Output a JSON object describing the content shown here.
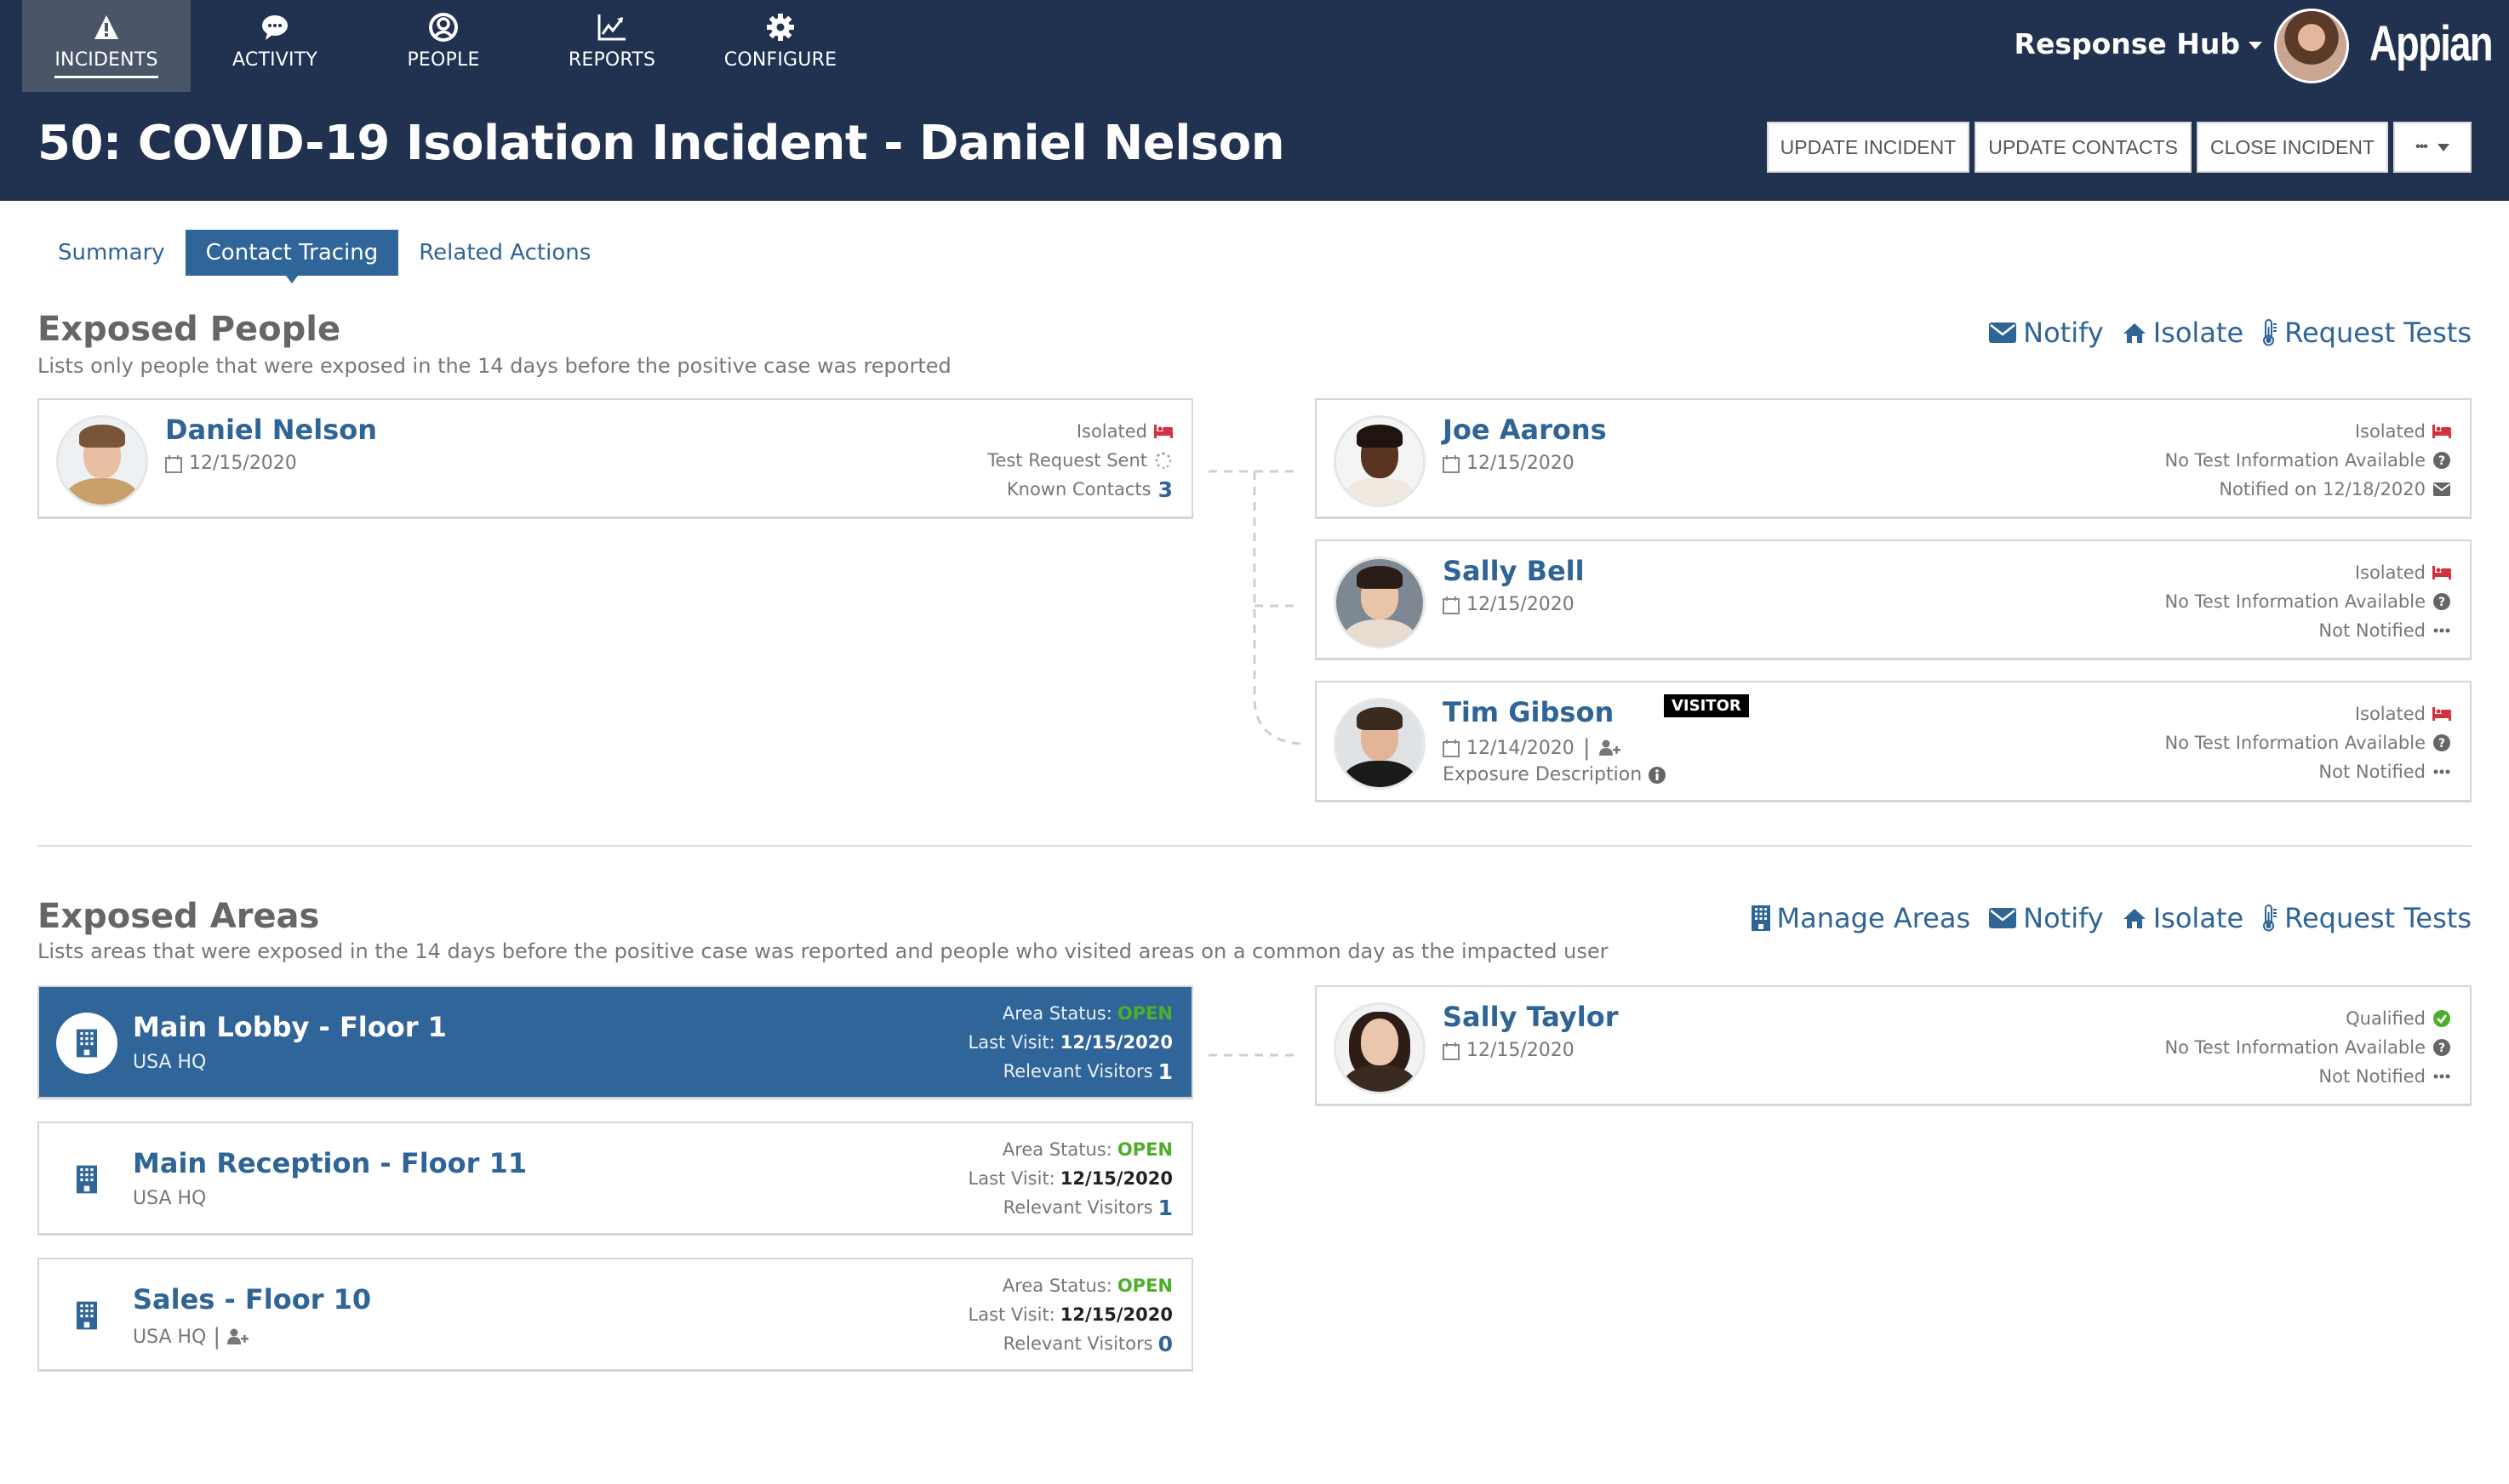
{
  "nav": {
    "items": [
      {
        "label": "INCIDENTS",
        "icon": "warning-icon",
        "active": true
      },
      {
        "label": "ACTIVITY",
        "icon": "chat-bubble-icon",
        "active": false
      },
      {
        "label": "PEOPLE",
        "icon": "user-circle-icon",
        "active": false
      },
      {
        "label": "REPORTS",
        "icon": "line-chart-icon",
        "active": false
      },
      {
        "label": "CONFIGURE",
        "icon": "gear-icon",
        "active": false
      }
    ],
    "site_name": "Response Hub",
    "logo": "Appian"
  },
  "header": {
    "title": "50: COVID-19 Isolation Incident - Daniel Nelson",
    "actions": [
      "UPDATE INCIDENT",
      "UPDATE CONTACTS",
      "CLOSE INCIDENT"
    ],
    "more_label": "•••"
  },
  "tabs": [
    {
      "label": "Summary",
      "active": false
    },
    {
      "label": "Contact Tracing",
      "active": true
    },
    {
      "label": "Related Actions",
      "active": false
    }
  ],
  "exposed_people": {
    "title": "Exposed People",
    "subtitle": "Lists only people that were exposed in the 14 days before the positive case was reported",
    "actions": [
      {
        "label": "Notify",
        "icon": "envelope-icon"
      },
      {
        "label": "Isolate",
        "icon": "home-icon"
      },
      {
        "label": "Request Tests",
        "icon": "thermometer-icon"
      }
    ],
    "index_case": {
      "name": "Daniel Nelson",
      "date": "12/15/2020",
      "status": [
        {
          "text": "Isolated",
          "icon": "bed-icon"
        },
        {
          "text": "Test Request Sent",
          "icon": "spinner-icon"
        },
        {
          "text": "Known Contacts",
          "value": "3"
        }
      ]
    },
    "contacts": [
      {
        "name": "Joe Aarons",
        "date": "12/15/2020",
        "status": [
          {
            "text": "Isolated",
            "icon": "bed-icon"
          },
          {
            "text": "No Test Information Available",
            "icon": "question-circle-icon"
          },
          {
            "text": "Notified on 12/18/2020",
            "icon": "envelope-icon"
          }
        ]
      },
      {
        "name": "Sally Bell",
        "date": "12/15/2020",
        "status": [
          {
            "text": "Isolated",
            "icon": "bed-icon"
          },
          {
            "text": "No Test Information Available",
            "icon": "question-circle-icon"
          },
          {
            "text": "Not Notified",
            "icon": "ellipsis-icon"
          }
        ]
      },
      {
        "name": "Tim Gibson",
        "date": "12/14/2020",
        "badge": "VISITOR",
        "extra": "Exposure Description",
        "status": [
          {
            "text": "Isolated",
            "icon": "bed-icon"
          },
          {
            "text": "No Test Information Available",
            "icon": "question-circle-icon"
          },
          {
            "text": "Not Notified",
            "icon": "ellipsis-icon"
          }
        ]
      }
    ]
  },
  "exposed_areas": {
    "title": "Exposed Areas",
    "subtitle": "Lists areas that were exposed in the 14 days before the positive case was reported and people who visited areas on a common day as the impacted user",
    "actions": [
      {
        "label": "Manage Areas",
        "icon": "building-icon"
      },
      {
        "label": "Notify",
        "icon": "envelope-icon"
      },
      {
        "label": "Isolate",
        "icon": "home-icon"
      },
      {
        "label": "Request Tests",
        "icon": "thermometer-icon"
      }
    ],
    "status_label": "Area Status:",
    "last_visit_label": "Last Visit:",
    "visitors_label": "Relevant Visitors",
    "areas": [
      {
        "name": "Main Lobby - Floor 1",
        "location": "USA HQ",
        "status": "OPEN",
        "last_visit": "12/15/2020",
        "visitors": "1",
        "selected": true
      },
      {
        "name": "Main Reception - Floor 11",
        "location": "USA HQ",
        "status": "OPEN",
        "last_visit": "12/15/2020",
        "visitors": "1",
        "selected": false
      },
      {
        "name": "Sales - Floor 10",
        "location": "USA HQ",
        "status": "OPEN",
        "last_visit": "12/15/2020",
        "visitors": "0",
        "selected": false
      }
    ],
    "visitors": [
      {
        "name": "Sally Taylor",
        "date": "12/15/2020",
        "status": [
          {
            "text": "Qualified",
            "icon": "check-circle-icon"
          },
          {
            "text": "No Test Information Available",
            "icon": "question-circle-icon"
          },
          {
            "text": "Not Notified",
            "icon": "ellipsis-icon"
          }
        ]
      }
    ]
  },
  "colors": {
    "nav_bg": "#213150",
    "accent": "#306599",
    "link": "#2f6496",
    "isolated": "#d0323f",
    "open": "#4caf2a"
  }
}
